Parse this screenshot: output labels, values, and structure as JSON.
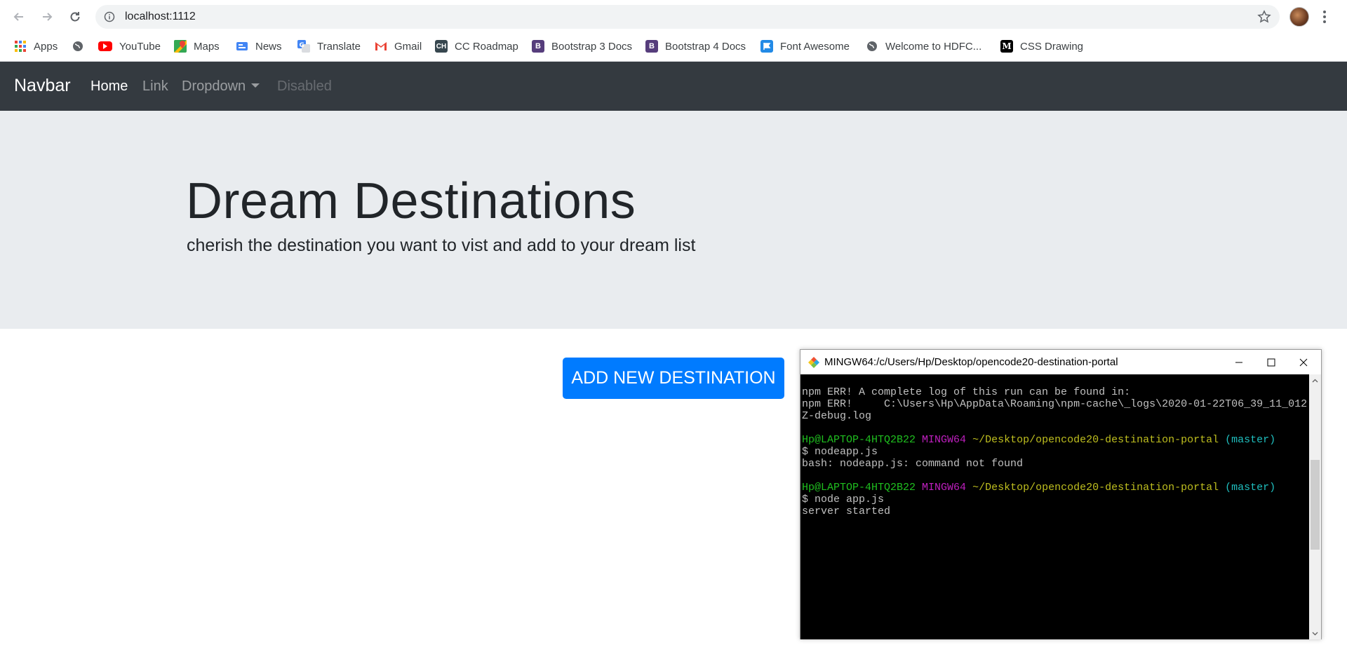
{
  "browser": {
    "url": "localhost:1112",
    "bookmarks": [
      {
        "label": "Apps",
        "icon": "apps-grid-icon"
      },
      {
        "label": "",
        "icon": "globe-icon"
      },
      {
        "label": "YouTube",
        "icon": "youtube-icon"
      },
      {
        "label": "Maps",
        "icon": "maps-icon"
      },
      {
        "label": "News",
        "icon": "news-icon"
      },
      {
        "label": "Translate",
        "icon": "translate-icon"
      },
      {
        "label": "Gmail",
        "icon": "gmail-icon"
      },
      {
        "label": "CC Roadmap",
        "icon": "ch-icon"
      },
      {
        "label": "Bootstrap 3 Docs",
        "icon": "bootstrap-icon"
      },
      {
        "label": "Bootstrap 4 Docs",
        "icon": "bootstrap-icon"
      },
      {
        "label": "Font Awesome",
        "icon": "font-awesome-flag-icon"
      },
      {
        "label": "Welcome to HDFC...",
        "icon": "globe-icon"
      },
      {
        "label": "CSS Drawing",
        "icon": "medium-icon"
      }
    ]
  },
  "navbar": {
    "brand": "Navbar",
    "links": {
      "home": "Home",
      "link": "Link",
      "dropdown": "Dropdown",
      "disabled": "Disabled"
    }
  },
  "jumbotron": {
    "title": "Dream Destinations",
    "subtitle": "cherish the destination you want to vist and add to your dream list"
  },
  "main": {
    "add_button": "ADD NEW DESTINATION"
  },
  "terminal": {
    "title": "MINGW64:/c/Users/Hp/Desktop/opencode20-destination-portal",
    "lines": {
      "l1": "npm ERR! A complete log of this run can be found in:",
      "l2": "npm ERR!     C:\\Users\\Hp\\AppData\\Roaming\\npm-cache\\_logs\\2020-01-22T06_39_11_012",
      "l3": "Z-debug.log",
      "p1_user": "Hp@LAPTOP-4HTQ2B22",
      "p1_sys": "MINGW64",
      "p1_path": "~/Desktop/opencode20-destination-portal",
      "p1_branch": "(master)",
      "c1": "$ nodeapp.js",
      "o1": "bash: nodeapp.js: command not found",
      "p2_user": "Hp@LAPTOP-4HTQ2B22",
      "p2_sys": "MINGW64",
      "p2_path": "~/Desktop/opencode20-destination-portal",
      "p2_branch": "(master)",
      "c2": "$ node app.js",
      "o2": "server started"
    }
  }
}
